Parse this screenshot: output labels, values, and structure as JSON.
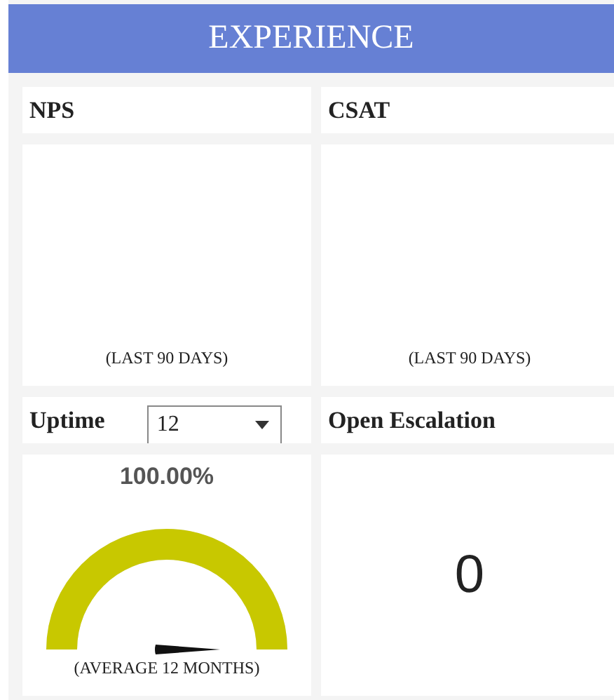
{
  "header": {
    "title": "EXPERIENCE"
  },
  "panels": [
    {
      "kind": "empty",
      "title": "NPS",
      "footer": "(LAST 90 DAYS)"
    },
    {
      "kind": "empty",
      "title": "CSAT",
      "footer": "(LAST 90 DAYS)"
    },
    {
      "kind": "gauge",
      "title": "Uptime",
      "select": {
        "value": "12"
      },
      "reading": "100.00%",
      "level": 1,
      "footer": "(AVERAGE 12 MONTHS)"
    },
    {
      "kind": "number",
      "title": "Open Escalation",
      "value": "0"
    }
  ]
}
